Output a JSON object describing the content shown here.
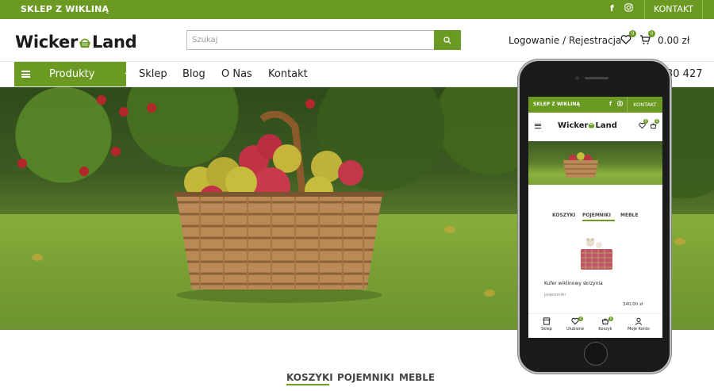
{
  "topbar": {
    "shop_name": "SKLEP Z WIKLINĄ",
    "facebook_glyph": "f",
    "contact_label": "KONTAKT"
  },
  "header": {
    "logo_left": "Wicker",
    "logo_right": "Land",
    "search_placeholder": "Szukaj",
    "login_label": "Logowanie / Rejestracja",
    "wishlist_count": "0",
    "cart_count": "0",
    "cart_total": "0.00 zł"
  },
  "nav": {
    "products_label": "Produkty",
    "items": [
      "Sklep",
      "Blog",
      "O Nas",
      "Kontakt"
    ],
    "phone_tail": "30 427"
  },
  "section_tabs": [
    "KOSZYKI",
    "POJEMNIKI",
    "MEBLE"
  ],
  "mobile": {
    "top_label": "SKLEP Z WIKLINĄ",
    "contact_label": "KONTAKT",
    "logo_left": "Wicker",
    "logo_right": "Land",
    "wishlist_count": "0",
    "cart_count": "0",
    "tabs": [
      "KOSZYKI",
      "POJEMNIKI",
      "MEBLE"
    ],
    "product": {
      "name": "Kufer wiklinowy skrzynia",
      "category": "pojemniki",
      "price": "340,00 zł"
    },
    "bottom_nav": [
      "Sklep",
      "Ulubione",
      "Koszyk",
      "Moje Konto"
    ],
    "bottom_badge_wishlist": "0",
    "bottom_badge_cart": "0"
  },
  "colors": {
    "brand_green": "#6a9a22",
    "text_dark": "#222222"
  }
}
